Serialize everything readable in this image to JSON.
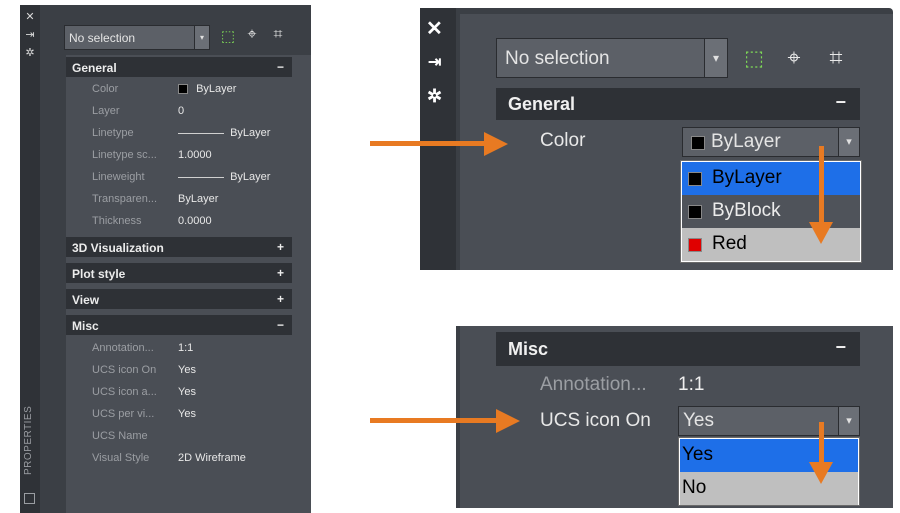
{
  "palette": {
    "strip_icons": [
      "close-icon",
      "auto-hide-icon",
      "properties-icon"
    ],
    "vertical_title": "PROPERTIES",
    "selection": {
      "value": "No selection"
    },
    "toolbar": [
      "toggle-pickadd-icon",
      "select-objects-icon",
      "quick-select-icon"
    ],
    "sections": {
      "general": {
        "label": "General",
        "toggle": "−"
      },
      "viz3d": {
        "label": "3D Visualization",
        "toggle": "+"
      },
      "plot": {
        "label": "Plot style",
        "toggle": "+"
      },
      "view": {
        "label": "View",
        "toggle": "+"
      },
      "misc": {
        "label": "Misc",
        "toggle": "−"
      }
    },
    "general_rows": [
      {
        "label": "Color",
        "value": "ByLayer"
      },
      {
        "label": "Layer",
        "value": "0"
      },
      {
        "label": "Linetype",
        "value": "ByLayer"
      },
      {
        "label": "Linetype sc...",
        "value": "1.0000"
      },
      {
        "label": "Lineweight",
        "value": "ByLayer"
      },
      {
        "label": "Transparen...",
        "value": "ByLayer"
      },
      {
        "label": "Thickness",
        "value": "0.0000"
      }
    ],
    "misc_rows": [
      {
        "label": "Annotation...",
        "value": "1:1"
      },
      {
        "label": "UCS icon On",
        "value": "Yes"
      },
      {
        "label": "UCS icon a...",
        "value": "Yes"
      },
      {
        "label": "UCS per vi...",
        "value": "Yes"
      },
      {
        "label": "UCS Name",
        "value": ""
      },
      {
        "label": "Visual Style",
        "value": "2D Wireframe"
      }
    ]
  },
  "zoom_top": {
    "selection": "No selection",
    "section": {
      "label": "General",
      "toggle": "−"
    },
    "row": {
      "label": "Color",
      "value": "ByLayer"
    },
    "options": [
      "ByLayer",
      "ByBlock",
      "Red"
    ]
  },
  "zoom_bottom": {
    "section": {
      "label": "Misc",
      "toggle": "−"
    },
    "row1": {
      "label": "Annotation...",
      "value": "1:1"
    },
    "row2": {
      "label": "UCS icon On",
      "value": "Yes"
    },
    "options": [
      "Yes",
      "No"
    ]
  },
  "colors": {
    "accent_orange": "#e87a22",
    "highlight_blue": "#1e6fe8",
    "panel_dark": "#3b3f45",
    "section_header": "#2e3136"
  }
}
